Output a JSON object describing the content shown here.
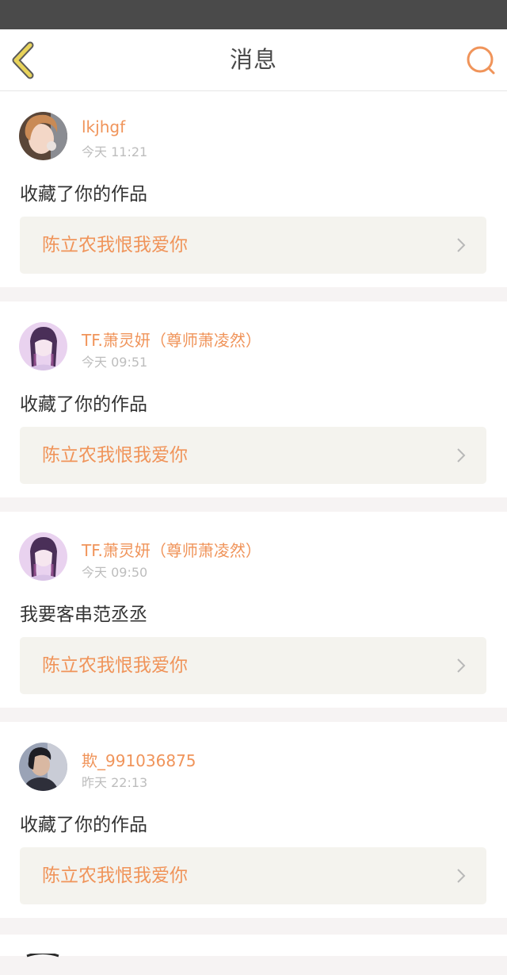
{
  "header": {
    "title": "消息",
    "back_icon": "chevron-left-icon",
    "search_icon": "search-icon"
  },
  "colors": {
    "accent": "#f0945a",
    "back_icon_yellow": "#e8d35a",
    "status_bar": "#4a4a4a"
  },
  "messages": [
    {
      "username": "lkjhgf",
      "time": "今天 11:21",
      "action": "收藏了你的作品",
      "work_title": "陈立农我恨我爱你"
    },
    {
      "username": "TF.萧灵妍（尊师萧凌然）",
      "time": "今天 09:51",
      "action": "收藏了你的作品",
      "work_title": "陈立农我恨我爱你"
    },
    {
      "username": "TF.萧灵妍（尊师萧凌然）",
      "time": "今天 09:50",
      "action": "我要客串范丞丞",
      "work_title": "陈立农我恨我爱你"
    },
    {
      "username": "欺_991036875",
      "time": "昨天 22:13",
      "action": "收藏了你的作品",
      "work_title": "陈立农我恨我爱你"
    }
  ]
}
